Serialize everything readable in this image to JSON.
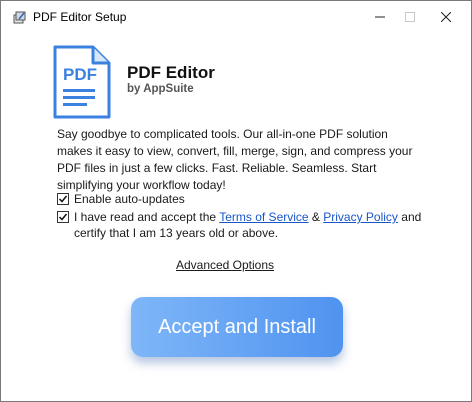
{
  "window": {
    "title": "PDF Editor Setup",
    "icon": "installer-icon"
  },
  "titlebar_buttons": {
    "minimize_icon": "minimize-icon",
    "maximize_icon": "maximize-icon",
    "close_icon": "close-icon"
  },
  "product": {
    "logo_text": "PDF",
    "name": "PDF Editor",
    "publisher": "by AppSuite"
  },
  "description": "Say goodbye to complicated tools. Our all-in-one PDF solution makes it easy to view, convert, fill, merge, sign, and compress your PDF files in just a few clicks. Fast. Reliable. Seamless. Start simplifying your workflow today!",
  "options": {
    "auto_updates": {
      "label": "Enable auto-updates",
      "checked": true
    },
    "terms": {
      "prefix": "I have read and accept the ",
      "terms_link": "Terms of Service",
      "ampersand": " & ",
      "privacy_link": "Privacy Policy",
      "suffix": " and certify that I am 13 years old or above.",
      "checked": true
    }
  },
  "advanced_options_label": "Advanced Options",
  "install_button_label": "Accept and Install",
  "colors": {
    "logo_blue": "#3b82e0",
    "link_blue": "#1a56c8",
    "button_gradient_start": "#7fb6f8",
    "button_gradient_end": "#4f93f0"
  }
}
